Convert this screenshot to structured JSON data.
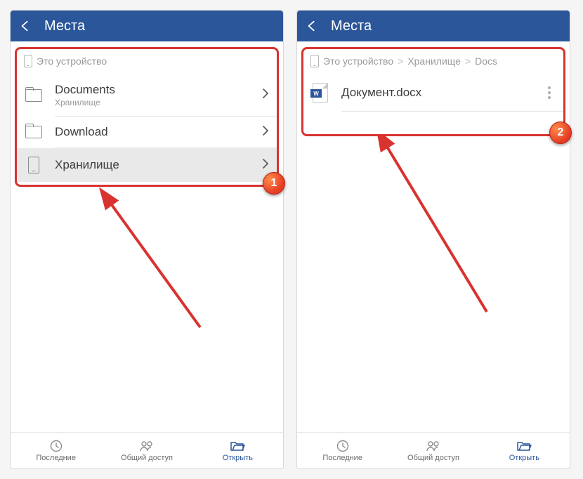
{
  "left": {
    "header": {
      "title": "Места"
    },
    "breadcrumb": {
      "device": "Это устройство"
    },
    "items": [
      {
        "title": "Documents",
        "subtitle": "Хранилище"
      },
      {
        "title": "Download"
      },
      {
        "title": "Хранилище"
      }
    ],
    "step": "1"
  },
  "right": {
    "header": {
      "title": "Места"
    },
    "breadcrumb": {
      "device": "Это устройство",
      "path1": "Хранилище",
      "path2": "Docs"
    },
    "file": {
      "name": "Документ.docx"
    },
    "step": "2"
  },
  "nav": {
    "recent": "Последние",
    "shared": "Общий доступ",
    "open": "Открыть"
  }
}
